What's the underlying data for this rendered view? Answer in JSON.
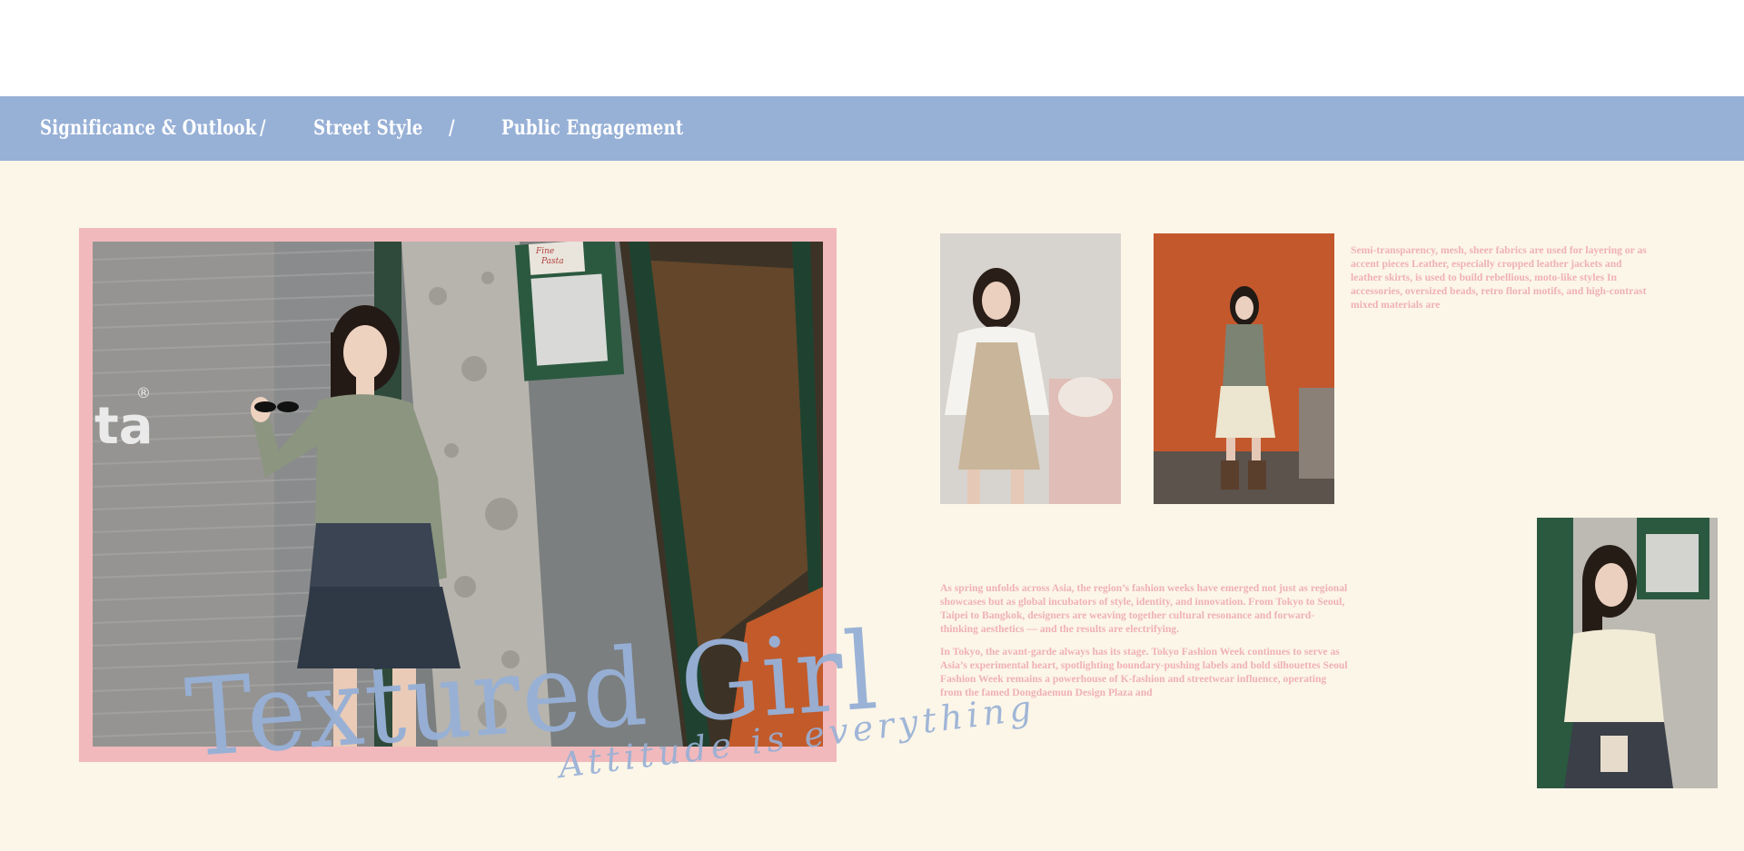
{
  "nav": {
    "items": [
      {
        "label": "Significance & Outlook"
      },
      {
        "label": "Street Style"
      },
      {
        "label": "Public Engagement"
      }
    ],
    "separator": "/"
  },
  "hero": {
    "storefront_text": "ta",
    "storefront_mark": "®",
    "sign_text_1": "Fine",
    "sign_text_2": "Pasta",
    "title": "Textured Girl",
    "tagline": "Attitude is everything"
  },
  "copy_1": {
    "text": "Semi-transparency, mesh, sheer fabrics are used for layering or as accent pieces Leather, especially cropped leather jackets and leather skirts, is used to build rebellious, moto-like styles In accessories, oversized beads, retro floral motifs, and high-contrast mixed materials are"
  },
  "copy_2": {
    "paragraphs": [
      "As spring unfolds across Asia, the region’s fashion weeks have emerged not just as regional showcases but as global incubators of style, identity, and innovation. From Tokyo to Seoul, Taipei to Bangkok, designers are weaving together cultural resonance and forward-thinking aesthetics — and the results are electrifying.",
      "In Tokyo, the avant-garde always has its stage. Tokyo Fashion Week continues to serve as Asia’s experimental heart, spotlighting boundary-pushing labels and bold silhouettes Seoul Fashion Week remains a powerhouse of K-fashion and streetwear influence, operating from the famed Dongdaemun Design Plaza and"
    ]
  },
  "colors": {
    "nav_bg": "#97b0d6",
    "page_bg": "#fcf6e8",
    "frame_pink": "#f1b9bc",
    "text_pink": "#efb1b6",
    "title_blue": "#97b0d6"
  }
}
